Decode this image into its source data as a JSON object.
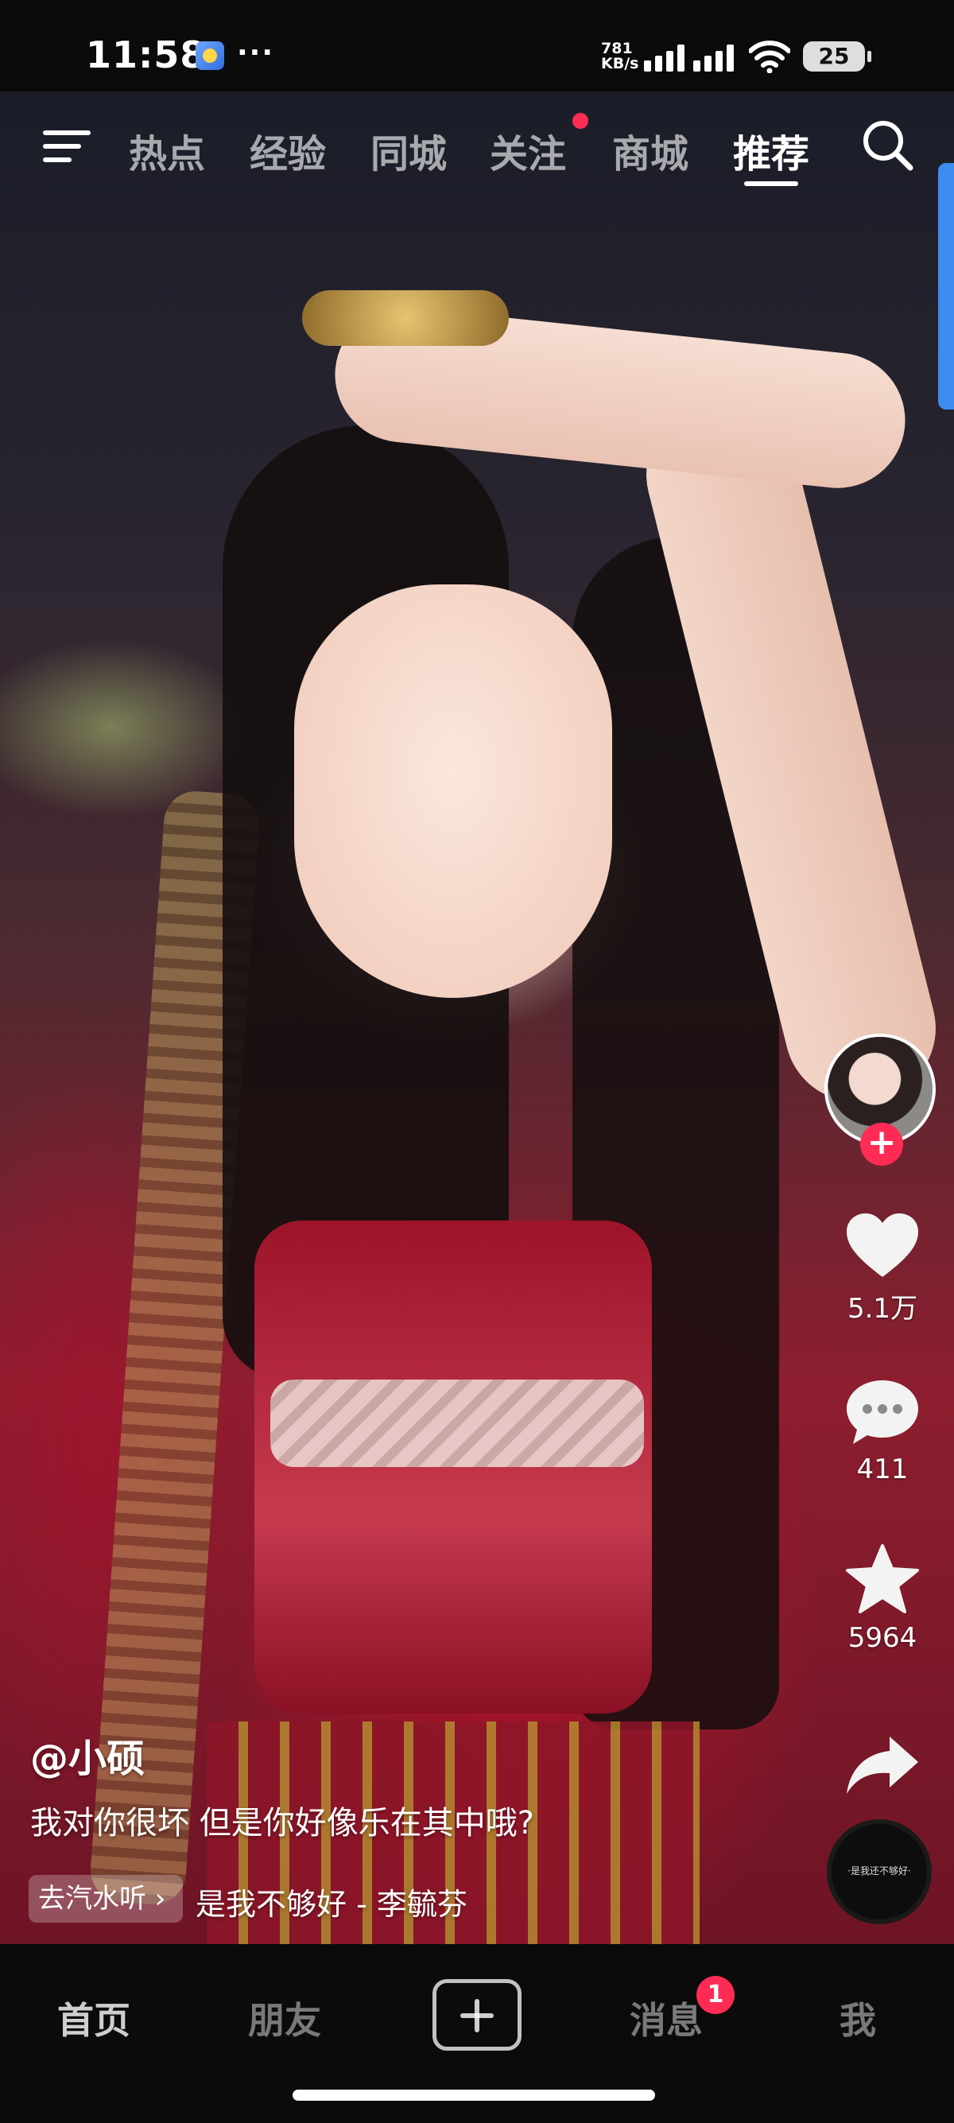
{
  "status_bar": {
    "time": "11:58",
    "more": "···",
    "net_speed_value": "781",
    "net_speed_unit": "KB/s",
    "battery": "25"
  },
  "top_nav": {
    "tabs": [
      {
        "label": "热点"
      },
      {
        "label": "经验"
      },
      {
        "label": "同城"
      },
      {
        "label": "关注",
        "has_dot": true
      },
      {
        "label": "商城"
      },
      {
        "label": "推荐",
        "active": true
      }
    ],
    "menu_icon": "menu-icon",
    "search_icon": "search-icon"
  },
  "side_rail": {
    "likes": "5.1万",
    "comments": "411",
    "favorites": "5964",
    "share_icon": "share-icon",
    "music_disc_text": "·是我还不够好·"
  },
  "post": {
    "author": "@小硕",
    "caption": "我对你很坏 但是你好像乐在其中哦?",
    "music_chip": "去汽水听 ›",
    "music_title": "是我不够好 - 李毓芬"
  },
  "bottom_nav": {
    "home": "首页",
    "friends": "朋友",
    "messages": "消息",
    "messages_badge": "1",
    "me": "我"
  },
  "colors": {
    "accent": "#fe2c55",
    "background": "#0b0b0b",
    "edge_bar": "#3d8cf0"
  }
}
